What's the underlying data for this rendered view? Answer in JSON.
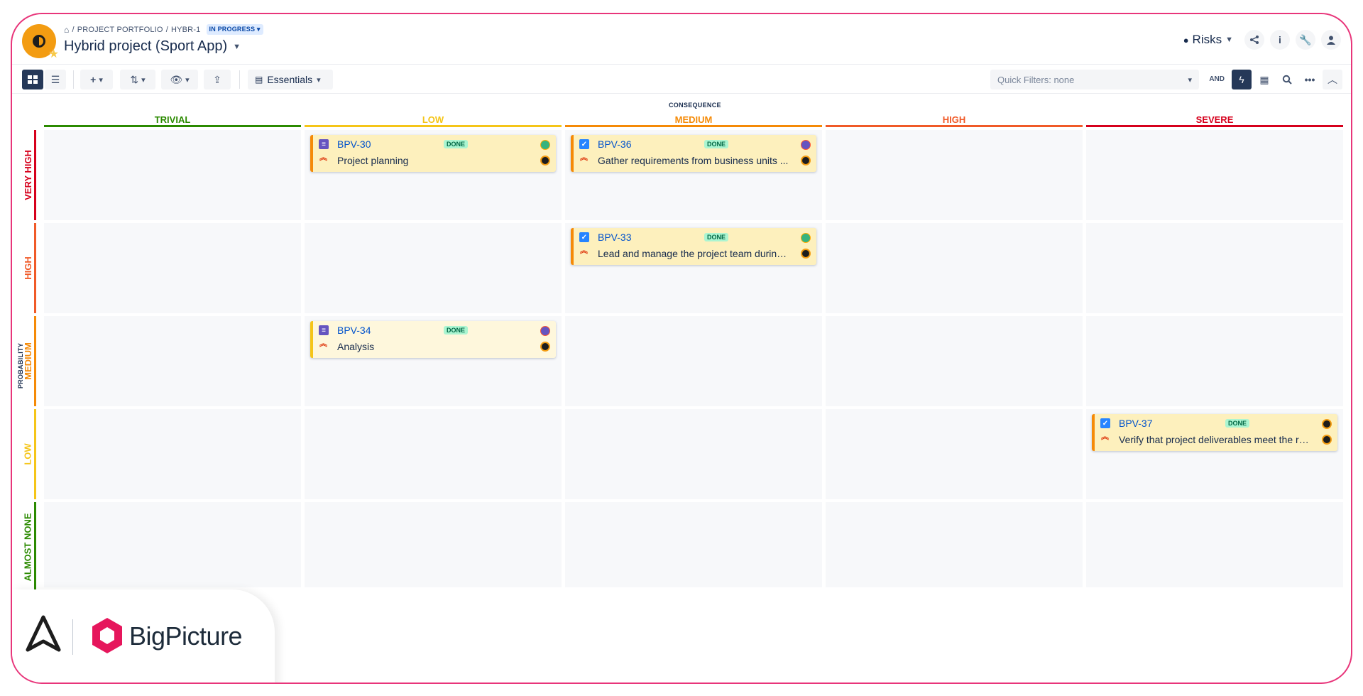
{
  "header": {
    "breadcrumb": [
      "PROJECT PORTFOLIO",
      "HYBR-1"
    ],
    "status_badge": "IN PROGRESS",
    "title": "Hybrid project (Sport App)",
    "risks_label": "Risks"
  },
  "toolbar": {
    "view_label": "Essentials",
    "quick_filter": "Quick Filters: none",
    "and_label": "AND"
  },
  "matrix": {
    "consequence_label": "CONSEQUENCE",
    "probability_label": "PROBABILITY",
    "columns": [
      {
        "label": "TRIVIAL",
        "color": "#2b8a00"
      },
      {
        "label": "LOW",
        "color": "#f5c518"
      },
      {
        "label": "MEDIUM",
        "color": "#f58a07"
      },
      {
        "label": "HIGH",
        "color": "#f05a28"
      },
      {
        "label": "SEVERE",
        "color": "#d6001c"
      }
    ],
    "rows": [
      {
        "label": "VERY HIGH",
        "color": "#d6001c"
      },
      {
        "label": "HIGH",
        "color": "#f05a28"
      },
      {
        "label": "MEDIUM",
        "color": "#f58a07"
      },
      {
        "label": "LOW",
        "color": "#f5c518"
      },
      {
        "label": "ALMOST NONE",
        "color": "#2b8a00"
      }
    ]
  },
  "cards": [
    {
      "key": "BPV-30",
      "status": "DONE",
      "summary": "Project planning",
      "type": "story-icon"
    },
    {
      "key": "BPV-36",
      "status": "DONE",
      "summary": "Gather requirements from business units ...",
      "type": "task-icon"
    },
    {
      "key": "BPV-33",
      "status": "DONE",
      "summary": "Lead and manage the project team during ...",
      "type": "task-icon"
    },
    {
      "key": "BPV-34",
      "status": "DONE",
      "summary": "Analysis",
      "type": "story-icon"
    },
    {
      "key": "BPV-37",
      "status": "DONE",
      "summary": "Verify that project deliverables meet the re...",
      "type": "task-icon"
    }
  ],
  "logo": {
    "text": "BigPicture"
  }
}
